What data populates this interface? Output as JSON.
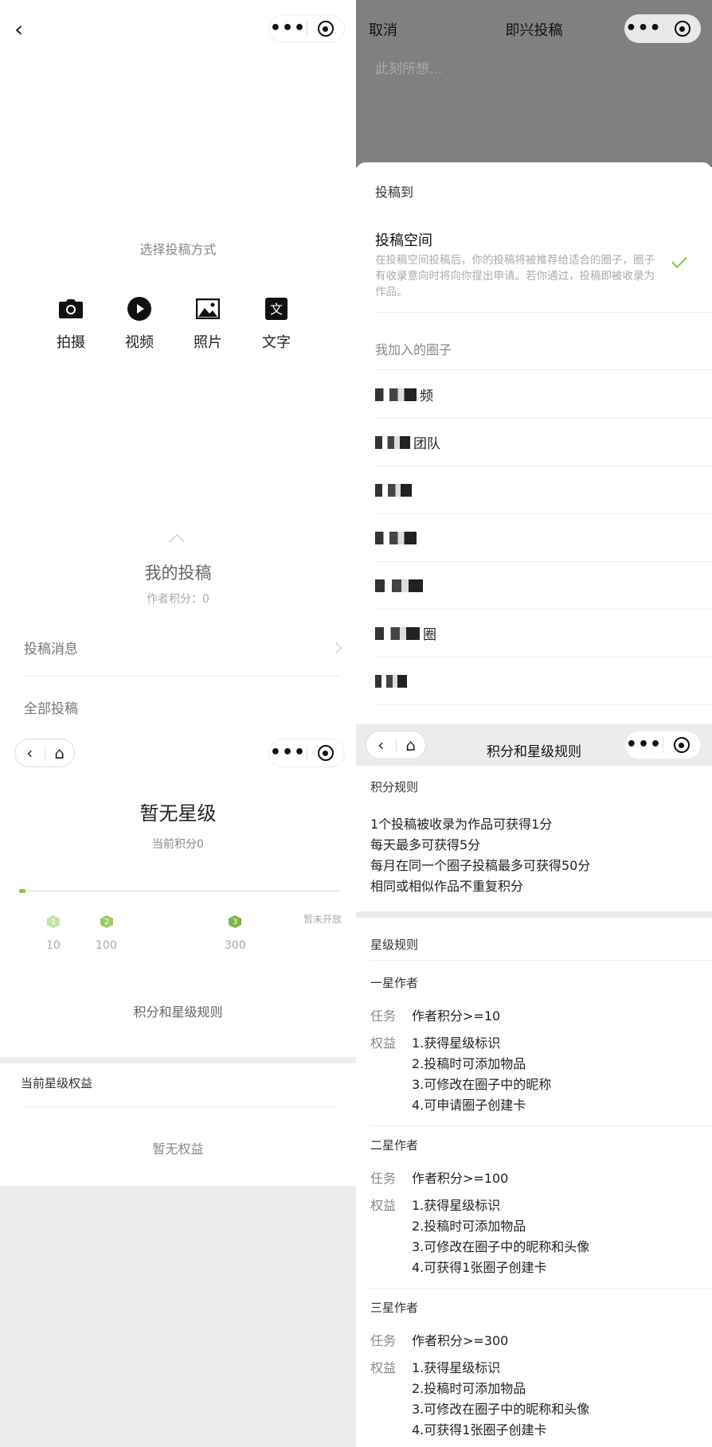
{
  "panel1": {
    "choose_title": "选择投稿方式",
    "methods": [
      {
        "label": "拍摄",
        "icon": "camera-icon"
      },
      {
        "label": "视频",
        "icon": "play-icon"
      },
      {
        "label": "照片",
        "icon": "image-icon"
      },
      {
        "label": "文字",
        "icon": "text-icon",
        "glyph": "文"
      }
    ],
    "my_title": "我的投稿",
    "my_score": "作者积分：0",
    "rows": [
      {
        "label": "投稿消息"
      },
      {
        "label": "全部投稿"
      }
    ]
  },
  "panel2": {
    "cancel": "取消",
    "title": "即兴投稿",
    "placeholder": "此刻所想...",
    "sheet_head": "投稿到",
    "space_title": "投稿空间",
    "space_desc": "在投稿空间投稿后，你的投稿将被推荐给适合的圈子，圈子有收录意向时将向你提出申请。若你通过，投稿即被收录为作品。",
    "joined_head": "我加入的圈子",
    "circles": [
      "频",
      "团队",
      "",
      "",
      "",
      "圈",
      ""
    ],
    "check_color": "#8bc34a"
  },
  "panel3": {
    "star_title": "暂无星级",
    "star_sub": "当前积分0",
    "progress": {
      "current": 0,
      "levels": [
        {
          "n": "1",
          "score": "10"
        },
        {
          "n": "2",
          "score": "100"
        },
        {
          "n": "3",
          "score": "300"
        }
      ],
      "last": "暂未开放"
    },
    "rules_link": "积分和星级规则",
    "benefit_head": "当前星级权益",
    "benefit_empty": "暂无权益",
    "accent": "#8bc34a"
  },
  "panel4": {
    "title": "积分和星级规则",
    "score_head": "积分规则",
    "score_rules": [
      "1个投稿被收录为作品可获得1分",
      "每天最多可获得5分",
      "每月在同一个圈子投稿最多可获得50分",
      "相同或相似作品不重复积分"
    ],
    "star_head": "星级规则",
    "task_label": "任务",
    "right_label": "权益",
    "levels": [
      {
        "name": "一星作者",
        "task": "作者积分>=10",
        "rights": [
          "1.获得星级标识",
          "2.投稿时可添加物品",
          "3.可修改在圈子中的昵称",
          "4.可申请圈子创建卡"
        ]
      },
      {
        "name": "二星作者",
        "task": "作者积分>=100",
        "rights": [
          "1.获得星级标识",
          "2.投稿时可添加物品",
          "3.可修改在圈子中的昵称和头像",
          "4.可获得1张圈子创建卡"
        ]
      },
      {
        "name": "三星作者",
        "task": "作者积分>=300",
        "rights": [
          "1.获得星级标识",
          "2.投稿时可添加物品",
          "3.可修改在圈子中的昵称和头像",
          "4.可获得1张圈子创建卡"
        ]
      }
    ]
  }
}
